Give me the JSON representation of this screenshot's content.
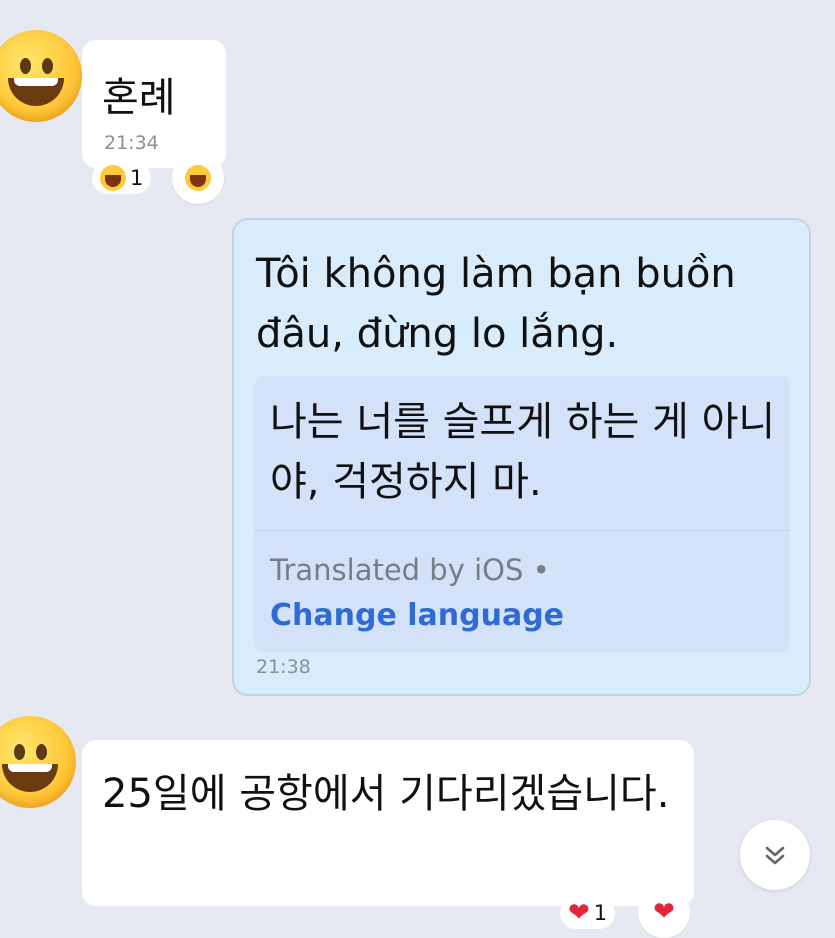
{
  "messages": [
    {
      "text": "혼례",
      "time": "21:34",
      "reaction_count": "1"
    },
    {
      "text": "Tôi không làm bạn buồn đâu, đừng lo lắng.",
      "translation": "나는 너를 슬프게 하는 게 아니야, 걱정하지 마.",
      "translated_by": "Translated by iOS •",
      "change_language": "Change language",
      "time": "21:38"
    },
    {
      "text": "25일에 공항에서 기다리겠습니다.",
      "reaction_count": "1"
    }
  ],
  "colors": {
    "background": "#e6e9f2",
    "outgoing_bubble": "#d8ecfb",
    "link": "#2f6bd6",
    "heart": "#e3243b"
  }
}
